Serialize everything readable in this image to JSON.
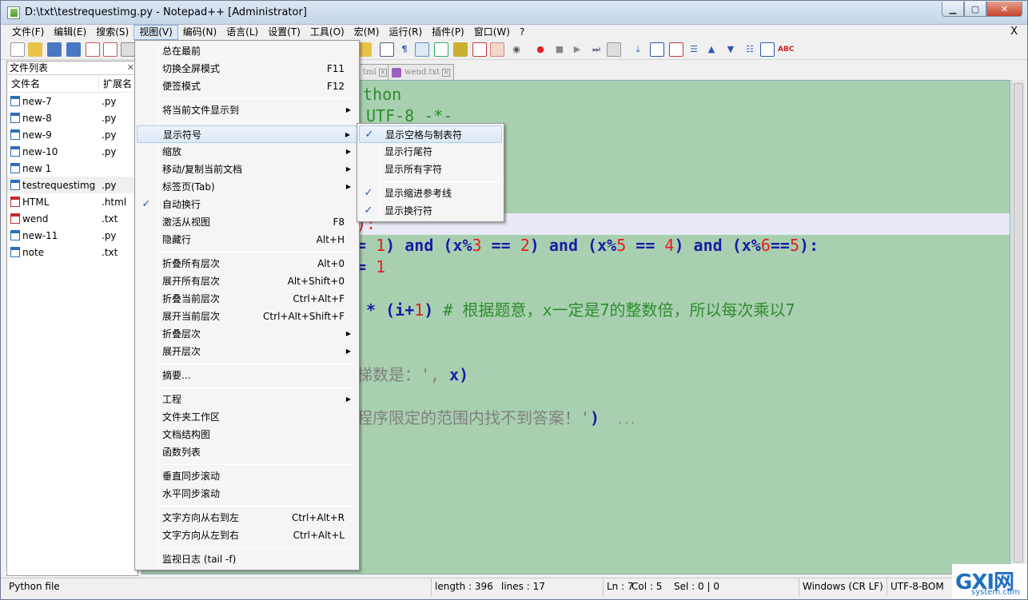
{
  "window": {
    "title": "D:\\txt\\testrequestimg.py - Notepad++ [Administrator]",
    "min": "▁",
    "max": "▢",
    "close": "✕"
  },
  "menubar": {
    "items": [
      "文件(F)",
      "编辑(E)",
      "搜索(S)",
      "视图(V)",
      "编码(N)",
      "语言(L)",
      "设置(T)",
      "工具(O)",
      "宏(M)",
      "运行(R)",
      "插件(P)",
      "窗口(W)",
      "?"
    ],
    "close_doc": "X"
  },
  "file_panel": {
    "title": "文件列表",
    "close": "✕",
    "col_name": "文件名",
    "col_ext": "扩展名",
    "files": [
      {
        "name": "new-7",
        "ext": ".py",
        "icon": "blue"
      },
      {
        "name": "new-8",
        "ext": ".py",
        "icon": "blue"
      },
      {
        "name": "new-9",
        "ext": ".py",
        "icon": "blue"
      },
      {
        "name": "new-10",
        "ext": ".py",
        "icon": "blue"
      },
      {
        "name": "new 1",
        "ext": "",
        "icon": "blue"
      },
      {
        "name": "testrequestimg",
        "ext": ".py",
        "icon": "blue"
      },
      {
        "name": "HTML",
        "ext": ".html",
        "icon": "red"
      },
      {
        "name": "wend",
        "ext": ".txt",
        "icon": "red"
      },
      {
        "name": "new-11",
        "ext": ".py",
        "icon": "blue"
      },
      {
        "name": "note",
        "ext": ".txt",
        "icon": "blue"
      }
    ]
  },
  "tabs": [
    {
      "label": "tml"
    },
    {
      "label": "wend.txt"
    }
  ],
  "code_lines": {
    "l1": "thon",
    "l2": "UTF-8 -*-",
    "l3a": "):",
    "l4": [
      "= ",
      "1",
      ") ",
      "and",
      " (x%",
      "3",
      " == ",
      "2",
      ") ",
      "and",
      " (x%",
      "5",
      " == ",
      "4",
      ") ",
      "and",
      " (x%",
      "6",
      "==",
      "5",
      "):"
    ],
    "l5": [
      "= ",
      "1"
    ],
    "l6": [
      " * ",
      "(i+",
      "1",
      ") ",
      "# 根据题意，x一定是7的整数倍，所以每次乘以7"
    ],
    "l7": [
      "梯数是：', ",
      "x)"
    ],
    "l8": [
      "程序限定的范围内找不到答案！'",
      ")",
      "..."
    ]
  },
  "view_menu": {
    "items": [
      {
        "label": "总在最前",
        "key": ""
      },
      {
        "label": "切换全屏模式",
        "key": "F11"
      },
      {
        "label": "便签模式",
        "key": "F12"
      },
      {
        "label": "将当前文件显示到",
        "key": "",
        "arrow": "▶"
      },
      {
        "label": "显示符号",
        "key": "",
        "arrow": "▶"
      },
      {
        "label": "缩放",
        "key": "",
        "arrow": "▶"
      },
      {
        "label": "移动/复制当前文档",
        "key": "",
        "arrow": "▶"
      },
      {
        "label": "标签页(Tab)",
        "key": "",
        "arrow": "▶"
      },
      {
        "label": "自动换行",
        "key": "",
        "check": "✓"
      },
      {
        "label": "激活从视图",
        "key": "F8"
      },
      {
        "label": "隐藏行",
        "key": "Alt+H"
      },
      {
        "label": "折叠所有层次",
        "key": "Alt+0"
      },
      {
        "label": "展开所有层次",
        "key": "Alt+Shift+0"
      },
      {
        "label": "折叠当前层次",
        "key": "Ctrl+Alt+F"
      },
      {
        "label": "展开当前层次",
        "key": "Ctrl+Alt+Shift+F"
      },
      {
        "label": "折叠层次",
        "key": "",
        "arrow": "▶"
      },
      {
        "label": "展开层次",
        "key": "",
        "arrow": "▶"
      },
      {
        "label": "摘要...",
        "key": ""
      },
      {
        "label": "工程",
        "key": "",
        "arrow": "▶"
      },
      {
        "label": "文件夹工作区",
        "key": ""
      },
      {
        "label": "文档结构图",
        "key": ""
      },
      {
        "label": "函数列表",
        "key": ""
      },
      {
        "label": "垂直同步滚动",
        "key": ""
      },
      {
        "label": "水平同步滚动",
        "key": ""
      },
      {
        "label": "文字方向从右到左",
        "key": "Ctrl+Alt+R"
      },
      {
        "label": "文字方向从左到右",
        "key": "Ctrl+Alt+L"
      },
      {
        "label": "监视日志 (tail -f)",
        "key": ""
      }
    ]
  },
  "symbol_submenu": {
    "items": [
      {
        "label": "显示空格与制表符",
        "check": "✓"
      },
      {
        "label": "显示行尾符",
        "check": ""
      },
      {
        "label": "显示所有字符",
        "check": ""
      },
      {
        "label": "显示缩进参考线",
        "check": "✓"
      },
      {
        "label": "显示换行符",
        "check": "✓"
      }
    ]
  },
  "statusbar": {
    "lang": "Python file",
    "length": "length : 396",
    "lines": "lines : 17",
    "ln": "Ln : 7",
    "col": "Col : 5",
    "sel": "Sel : 0 | 0",
    "eol": "Windows (CR LF)",
    "encoding": "UTF-8-BOM"
  },
  "watermark": {
    "line1": "GXI网",
    "line2": "system.com"
  }
}
